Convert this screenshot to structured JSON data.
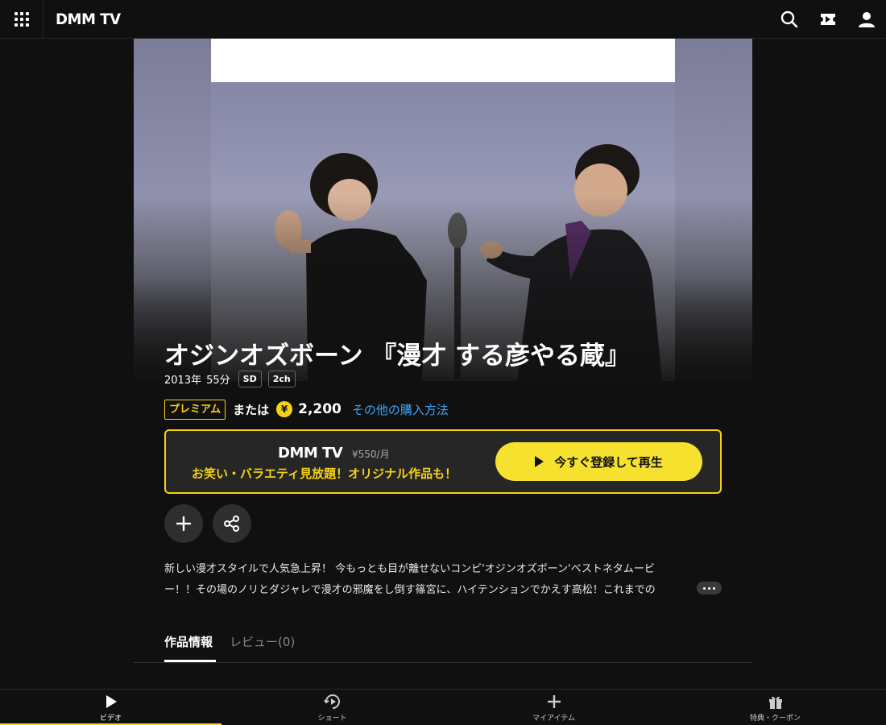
{
  "header": {
    "logo": "DMM TV",
    "icons": [
      "menu-grid-icon",
      "search-icon",
      "ticket-icon",
      "user-icon"
    ]
  },
  "content": {
    "title": "オジンオズボーン 『漫才 する彦やる蔵』",
    "year": "2013年",
    "duration": "55分",
    "badges": [
      "SD",
      "2ch"
    ],
    "premium_label": "プレミアム",
    "or_label": "または",
    "yen_symbol": "¥",
    "price": "2,200",
    "other_purchase": "その他の購入方法",
    "description_line1": "新しい漫才スタイルで人気急上昇！ 今もっとも目が離せないコンビ'オジンオズボーン'ベストネタムービ",
    "description_line2": "ー！！その場のノリとダジャレで漫才の邪魔をし倒す篠宮に、ハイテンションでかえす高松！これまでの"
  },
  "promo": {
    "logo": "DMM TV",
    "monthly_price": "¥550/月",
    "tagline": "お笑い・バラエティ見放題！オリジナル作品も！",
    "cta_label": "今すぐ登録して再生"
  },
  "tabs": {
    "info": "作品情報",
    "review": "レビュー(0)"
  },
  "bottom_nav": {
    "video": "ビデオ",
    "short": "ショート",
    "my_items": "マイアイテム",
    "coupons": "特典・クーポン"
  },
  "colors": {
    "accent": "#f5d312",
    "link": "#3aa6ff",
    "background": "#101010",
    "panel": "#262626"
  }
}
